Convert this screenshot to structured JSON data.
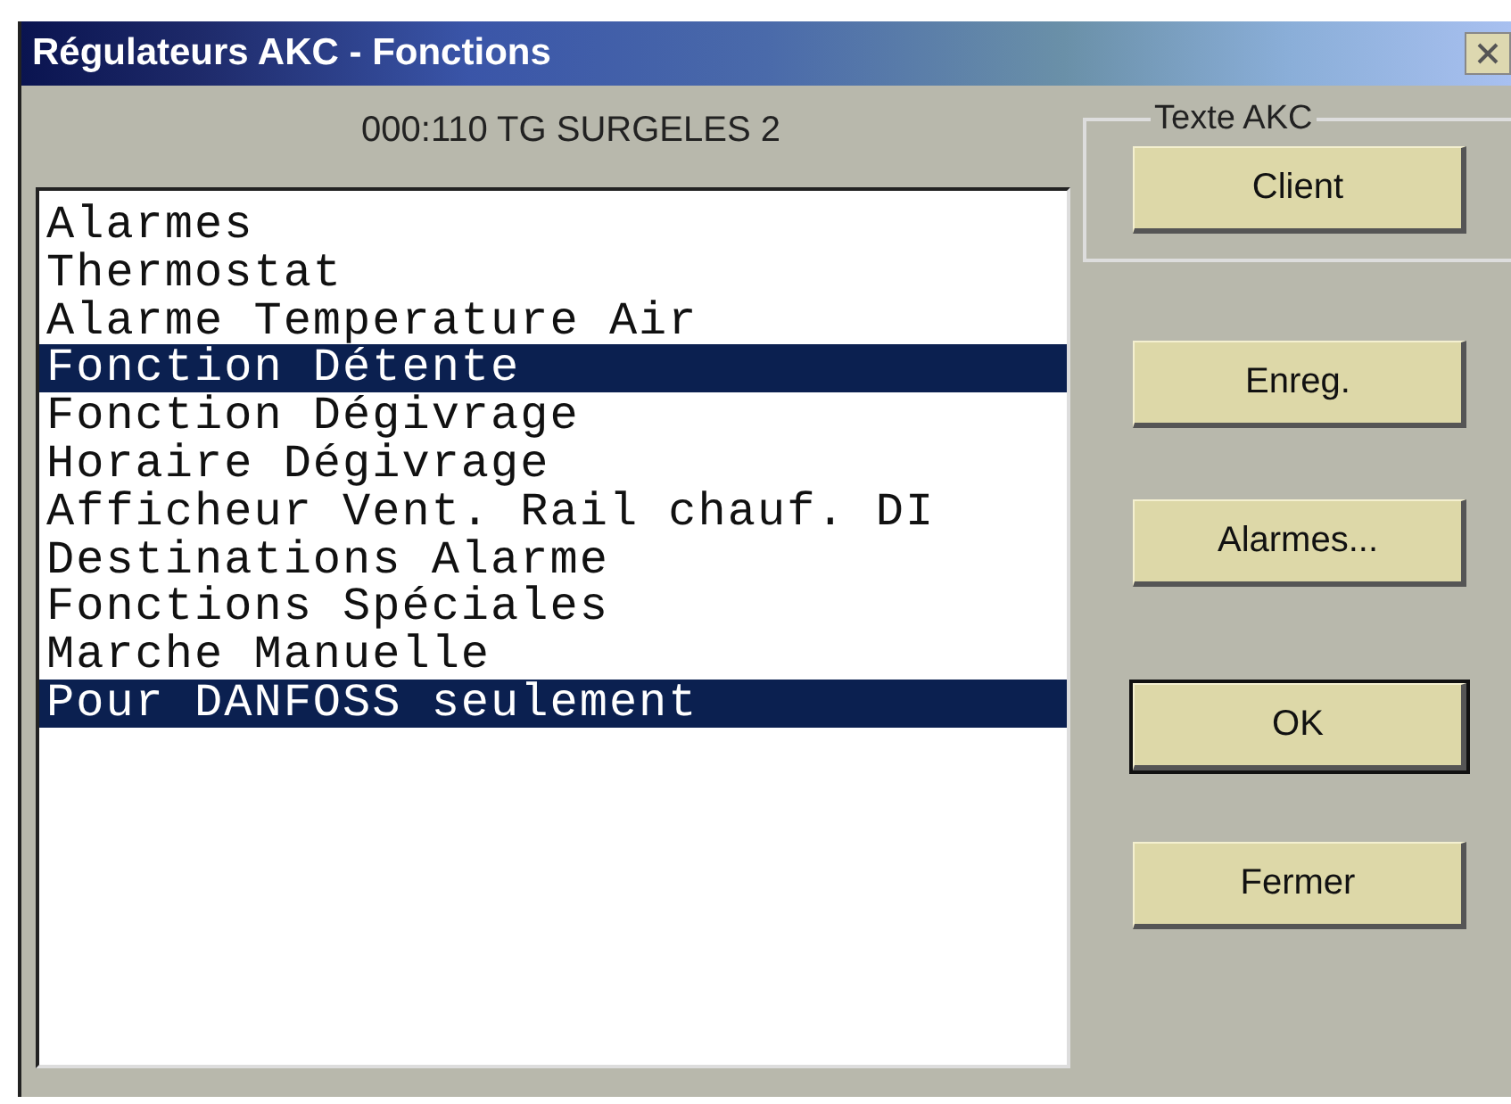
{
  "window": {
    "title": "Régulateurs AKC - Fonctions"
  },
  "subtitle": "000:110  TG SURGELES 2",
  "functions": [
    {
      "label": "Alarmes",
      "selected": false
    },
    {
      "label": "Thermostat",
      "selected": false
    },
    {
      "label": "Alarme Temperature Air",
      "selected": false
    },
    {
      "label": "Fonction Détente",
      "selected": true
    },
    {
      "label": "Fonction Dégivrage",
      "selected": false
    },
    {
      "label": "Horaire Dégivrage",
      "selected": false
    },
    {
      "label": "Afficheur Vent. Rail chauf. DI",
      "selected": false
    },
    {
      "label": "Destinations Alarme",
      "selected": false
    },
    {
      "label": "Fonctions Spéciales",
      "selected": false
    },
    {
      "label": "Marche Manuelle",
      "selected": false
    },
    {
      "label": "Pour DANFOSS seulement",
      "selected": true
    }
  ],
  "group": {
    "title": "Texte AKC",
    "buttons": [
      {
        "label": "Client",
        "default": false
      }
    ]
  },
  "buttons": [
    {
      "label": "Enreg.",
      "default": false
    },
    {
      "label": "Alarmes...",
      "default": false
    },
    {
      "label": "OK",
      "default": true
    },
    {
      "label": "Fermer",
      "default": false
    }
  ]
}
